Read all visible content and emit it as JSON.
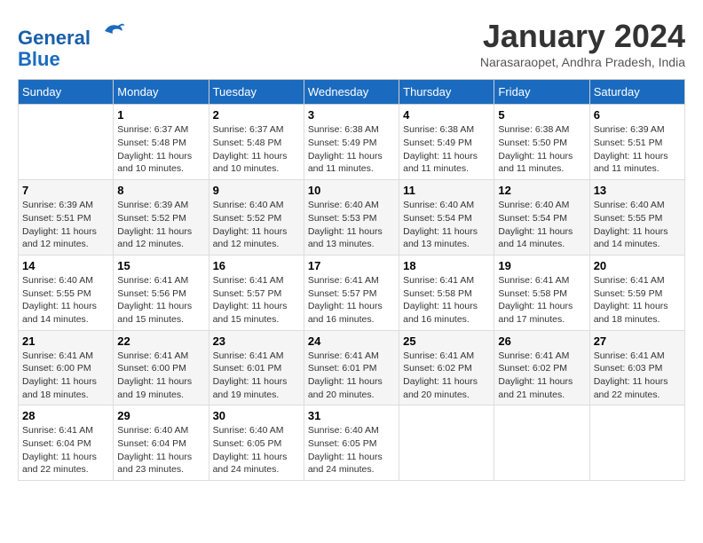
{
  "header": {
    "logo_line1": "General",
    "logo_line2": "Blue",
    "month": "January 2024",
    "location": "Narasaraopet, Andhra Pradesh, India"
  },
  "days_of_week": [
    "Sunday",
    "Monday",
    "Tuesday",
    "Wednesday",
    "Thursday",
    "Friday",
    "Saturday"
  ],
  "weeks": [
    [
      {
        "day": "",
        "info": ""
      },
      {
        "day": "1",
        "info": "Sunrise: 6:37 AM\nSunset: 5:48 PM\nDaylight: 11 hours\nand 10 minutes."
      },
      {
        "day": "2",
        "info": "Sunrise: 6:37 AM\nSunset: 5:48 PM\nDaylight: 11 hours\nand 10 minutes."
      },
      {
        "day": "3",
        "info": "Sunrise: 6:38 AM\nSunset: 5:49 PM\nDaylight: 11 hours\nand 11 minutes."
      },
      {
        "day": "4",
        "info": "Sunrise: 6:38 AM\nSunset: 5:49 PM\nDaylight: 11 hours\nand 11 minutes."
      },
      {
        "day": "5",
        "info": "Sunrise: 6:38 AM\nSunset: 5:50 PM\nDaylight: 11 hours\nand 11 minutes."
      },
      {
        "day": "6",
        "info": "Sunrise: 6:39 AM\nSunset: 5:51 PM\nDaylight: 11 hours\nand 11 minutes."
      }
    ],
    [
      {
        "day": "7",
        "info": "Sunrise: 6:39 AM\nSunset: 5:51 PM\nDaylight: 11 hours\nand 12 minutes."
      },
      {
        "day": "8",
        "info": "Sunrise: 6:39 AM\nSunset: 5:52 PM\nDaylight: 11 hours\nand 12 minutes."
      },
      {
        "day": "9",
        "info": "Sunrise: 6:40 AM\nSunset: 5:52 PM\nDaylight: 11 hours\nand 12 minutes."
      },
      {
        "day": "10",
        "info": "Sunrise: 6:40 AM\nSunset: 5:53 PM\nDaylight: 11 hours\nand 13 minutes."
      },
      {
        "day": "11",
        "info": "Sunrise: 6:40 AM\nSunset: 5:54 PM\nDaylight: 11 hours\nand 13 minutes."
      },
      {
        "day": "12",
        "info": "Sunrise: 6:40 AM\nSunset: 5:54 PM\nDaylight: 11 hours\nand 14 minutes."
      },
      {
        "day": "13",
        "info": "Sunrise: 6:40 AM\nSunset: 5:55 PM\nDaylight: 11 hours\nand 14 minutes."
      }
    ],
    [
      {
        "day": "14",
        "info": "Sunrise: 6:40 AM\nSunset: 5:55 PM\nDaylight: 11 hours\nand 14 minutes."
      },
      {
        "day": "15",
        "info": "Sunrise: 6:41 AM\nSunset: 5:56 PM\nDaylight: 11 hours\nand 15 minutes."
      },
      {
        "day": "16",
        "info": "Sunrise: 6:41 AM\nSunset: 5:57 PM\nDaylight: 11 hours\nand 15 minutes."
      },
      {
        "day": "17",
        "info": "Sunrise: 6:41 AM\nSunset: 5:57 PM\nDaylight: 11 hours\nand 16 minutes."
      },
      {
        "day": "18",
        "info": "Sunrise: 6:41 AM\nSunset: 5:58 PM\nDaylight: 11 hours\nand 16 minutes."
      },
      {
        "day": "19",
        "info": "Sunrise: 6:41 AM\nSunset: 5:58 PM\nDaylight: 11 hours\nand 17 minutes."
      },
      {
        "day": "20",
        "info": "Sunrise: 6:41 AM\nSunset: 5:59 PM\nDaylight: 11 hours\nand 18 minutes."
      }
    ],
    [
      {
        "day": "21",
        "info": "Sunrise: 6:41 AM\nSunset: 6:00 PM\nDaylight: 11 hours\nand 18 minutes."
      },
      {
        "day": "22",
        "info": "Sunrise: 6:41 AM\nSunset: 6:00 PM\nDaylight: 11 hours\nand 19 minutes."
      },
      {
        "day": "23",
        "info": "Sunrise: 6:41 AM\nSunset: 6:01 PM\nDaylight: 11 hours\nand 19 minutes."
      },
      {
        "day": "24",
        "info": "Sunrise: 6:41 AM\nSunset: 6:01 PM\nDaylight: 11 hours\nand 20 minutes."
      },
      {
        "day": "25",
        "info": "Sunrise: 6:41 AM\nSunset: 6:02 PM\nDaylight: 11 hours\nand 20 minutes."
      },
      {
        "day": "26",
        "info": "Sunrise: 6:41 AM\nSunset: 6:02 PM\nDaylight: 11 hours\nand 21 minutes."
      },
      {
        "day": "27",
        "info": "Sunrise: 6:41 AM\nSunset: 6:03 PM\nDaylight: 11 hours\nand 22 minutes."
      }
    ],
    [
      {
        "day": "28",
        "info": "Sunrise: 6:41 AM\nSunset: 6:04 PM\nDaylight: 11 hours\nand 22 minutes."
      },
      {
        "day": "29",
        "info": "Sunrise: 6:40 AM\nSunset: 6:04 PM\nDaylight: 11 hours\nand 23 minutes."
      },
      {
        "day": "30",
        "info": "Sunrise: 6:40 AM\nSunset: 6:05 PM\nDaylight: 11 hours\nand 24 minutes."
      },
      {
        "day": "31",
        "info": "Sunrise: 6:40 AM\nSunset: 6:05 PM\nDaylight: 11 hours\nand 24 minutes."
      },
      {
        "day": "",
        "info": ""
      },
      {
        "day": "",
        "info": ""
      },
      {
        "day": "",
        "info": ""
      }
    ]
  ]
}
